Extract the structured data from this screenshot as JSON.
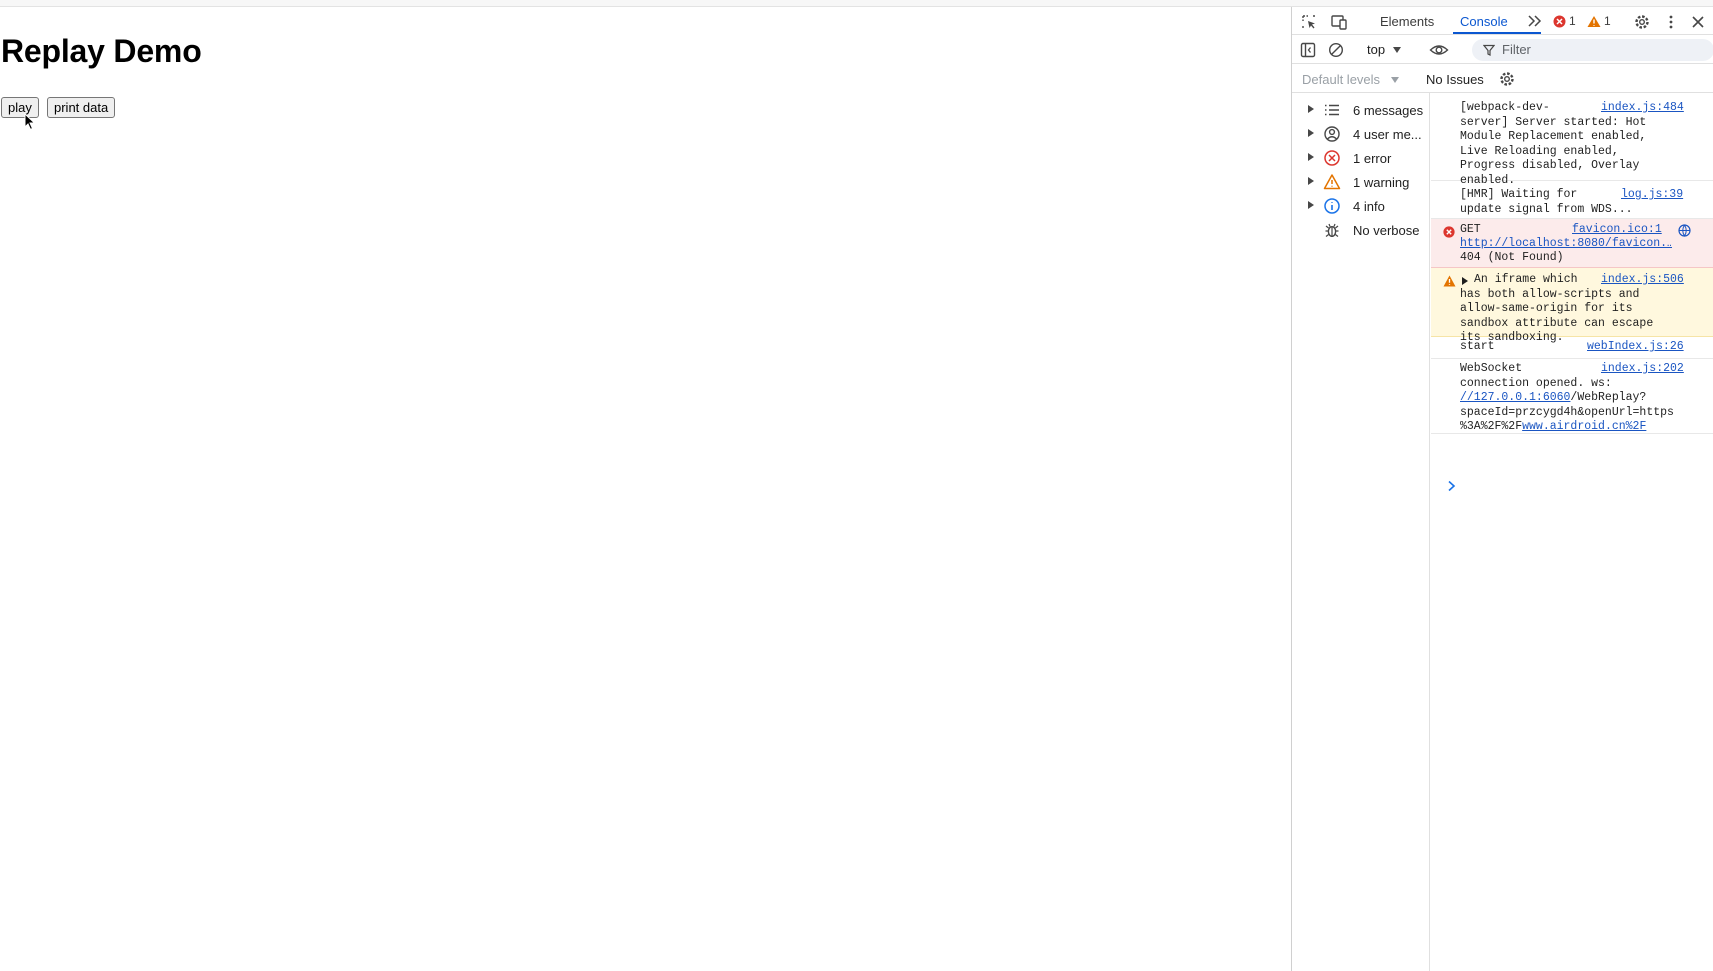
{
  "page": {
    "title": "Replay Demo",
    "play_button": "play",
    "print_button": "print data"
  },
  "devtools": {
    "tabs": {
      "elements": "Elements",
      "console": "Console"
    },
    "error_count": "1",
    "warning_count": "1",
    "context": "top",
    "filter_placeholder": "Filter",
    "levels": "Default levels",
    "issues": "No Issues",
    "sidebar": [
      {
        "label": "6 messages",
        "icon": "list-icon"
      },
      {
        "label": "4 user me...",
        "icon": "user-icon"
      },
      {
        "label": "1 error",
        "icon": "error-icon"
      },
      {
        "label": "1 warning",
        "icon": "warning-icon"
      },
      {
        "label": "4 info",
        "icon": "info-icon"
      },
      {
        "label": "No verbose",
        "icon": "bug-icon"
      }
    ],
    "messages": [
      {
        "text": "[webpack-dev-\nserver] Server started: Hot\nModule Replacement enabled,\nLive Reloading enabled,\nProgress disabled, Overlay\nenabled.",
        "source": "index.js:484"
      },
      {
        "text": "[HMR] Waiting for\nupdate signal from WDS...",
        "source": "log.js:39"
      },
      {
        "prefix": "GET",
        "link": "http://localhost:8080/favicon.…",
        "suffix": "404 (Not Found)",
        "source": "favicon.ico:1"
      },
      {
        "text": "An iframe which\nhas both allow-scripts and\nallow-same-origin for its\nsandbox attribute can escape\nits sandboxing.",
        "source": "index.js:506"
      },
      {
        "text": "start",
        "source": "webIndex.js:26"
      },
      {
        "line1": "WebSocket",
        "line2": "connection opened. ws:",
        "link1": "//127.0.0.1:6060",
        "line3": "/WebReplay?",
        "line4": "spaceId=przcygd4h&openUrl=https",
        "line5": "%3A%2F%2F",
        "link2": "www.airdroid.cn%2F",
        "source": "index.js:202"
      }
    ]
  }
}
